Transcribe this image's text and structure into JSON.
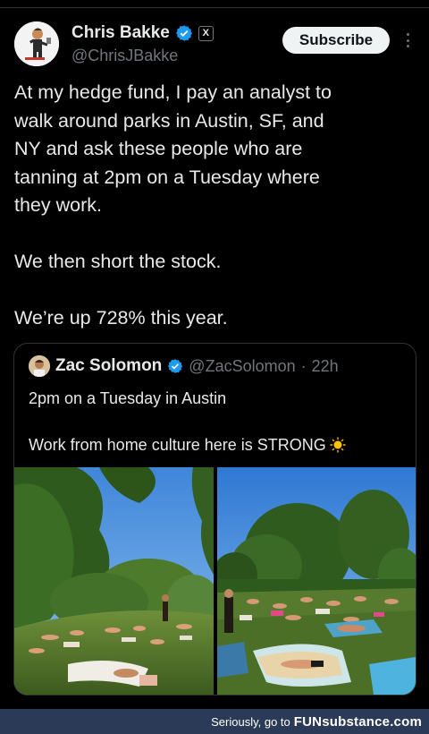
{
  "author": {
    "name": "Chris Bakke",
    "handle": "@ChrisJBakke",
    "x_badge": "X"
  },
  "subscribe_label": "Subscribe",
  "tweet_lines": [
    "At my hedge fund, I pay an analyst to",
    "walk around parks in Austin, SF, and",
    "NY and ask these people who are",
    "tanning at 2pm on a Tuesday where",
    "they work.",
    "We then short the stock.",
    "We’re up 728% this year."
  ],
  "quote": {
    "name": "Zac Solomon",
    "handle": "@ZacSolomon",
    "separator": "·",
    "time": "22h",
    "line1": "2pm on a Tuesday in Austin",
    "line2": "Work from home culture here is STRONG"
  },
  "footer": {
    "text": "Seriously, go to",
    "logo": "FUNsubstance.com"
  },
  "colors": {
    "background": "#000000",
    "verified": "#1d9bf0",
    "footer_bg": "#2b3a56"
  }
}
